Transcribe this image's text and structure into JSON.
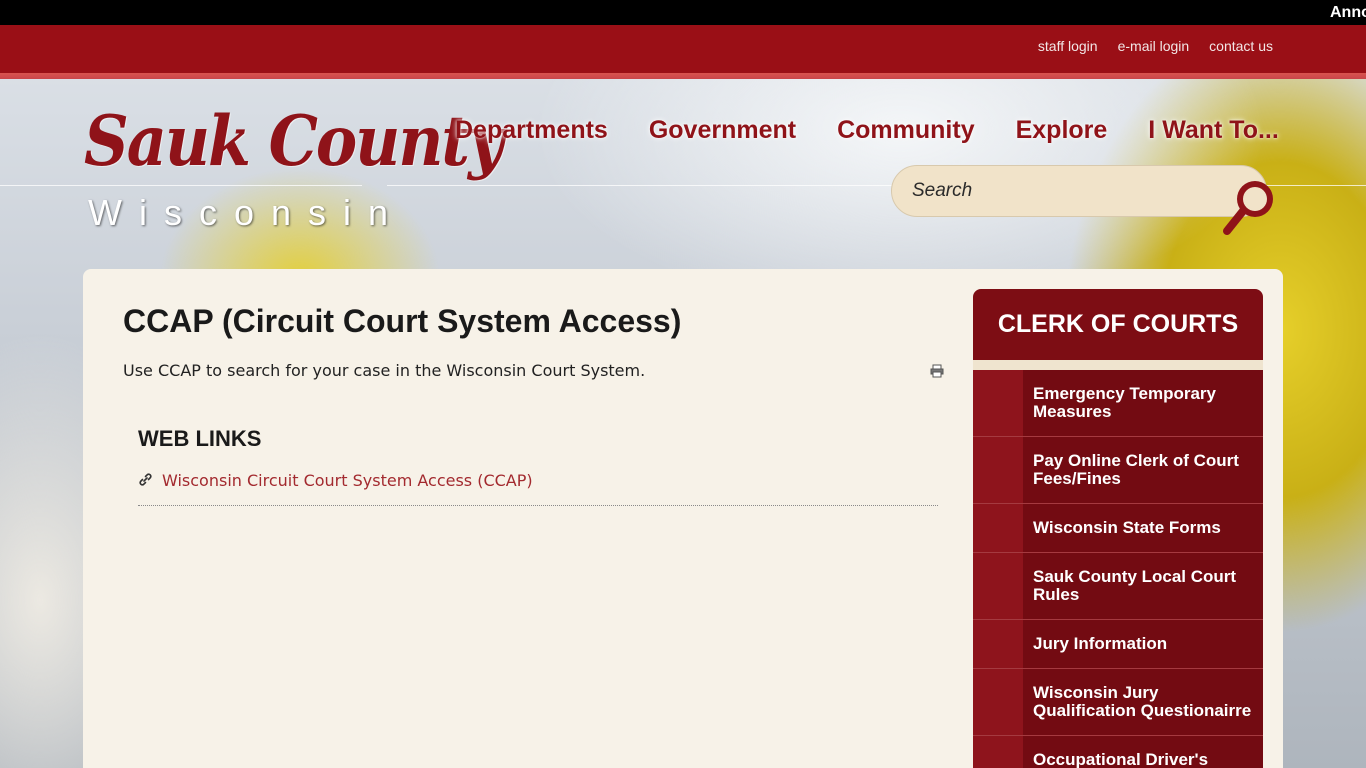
{
  "announcement": {
    "text": "Announcements"
  },
  "utility_nav": {
    "links": [
      "staff login",
      "e-mail login",
      "contact us"
    ]
  },
  "logo": {
    "name": "Sauk County",
    "subtitle": "Wisconsin"
  },
  "main_nav": {
    "items": [
      "Departments",
      "Government",
      "Community",
      "Explore",
      "I Want To..."
    ]
  },
  "search": {
    "placeholder": "Search"
  },
  "content": {
    "title": "CCAP (Circuit Court System Access)",
    "description": "Use CCAP to search for your case in the Wisconsin Court System.",
    "section_heading": "WEB LINKS",
    "links": [
      "Wisconsin Circuit Court System Access (CCAP)"
    ]
  },
  "sidebar": {
    "title": "CLERK OF COURTS",
    "items": [
      "Emergency Temporary Measures",
      "Pay Online Clerk of Court Fees/Fines",
      "Wisconsin State Forms",
      "Sauk County Local Court Rules",
      "Jury Information",
      "Wisconsin Jury Qualification Questionairre",
      "Occupational Driver's"
    ]
  },
  "colors": {
    "brand_red": "#9a0f16",
    "sidebar_dark": "#730b12",
    "sidebar_accent": "#8e141c",
    "card_bg": "#f7f2e8",
    "search_bg": "#f1e3c9",
    "link_red": "#a32a2f"
  },
  "icons": [
    "search-icon",
    "print-icon",
    "link-icon"
  ]
}
